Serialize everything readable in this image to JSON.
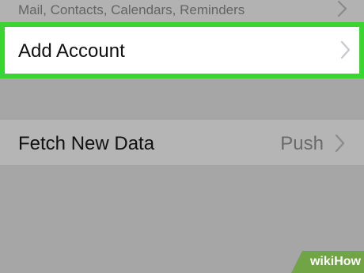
{
  "top_cell": {
    "subtitle": "Mail, Contacts, Calendars, Reminders",
    "chevron_icon": "chevron-right-icon"
  },
  "add_account": {
    "label": "Add Account",
    "chevron_icon": "chevron-right-icon",
    "highlight_color": "#38d62e"
  },
  "fetch_new_data": {
    "label": "Fetch New Data",
    "value": "Push",
    "chevron_icon": "chevron-right-icon"
  },
  "watermark": {
    "wiki": "wiki",
    "how": "How"
  },
  "colors": {
    "background": "#a6a6a6",
    "cell_dimmed": "#b5b5b5",
    "cell_highlighted": "#ffffff",
    "secondary_text": "#6a6a6a"
  }
}
